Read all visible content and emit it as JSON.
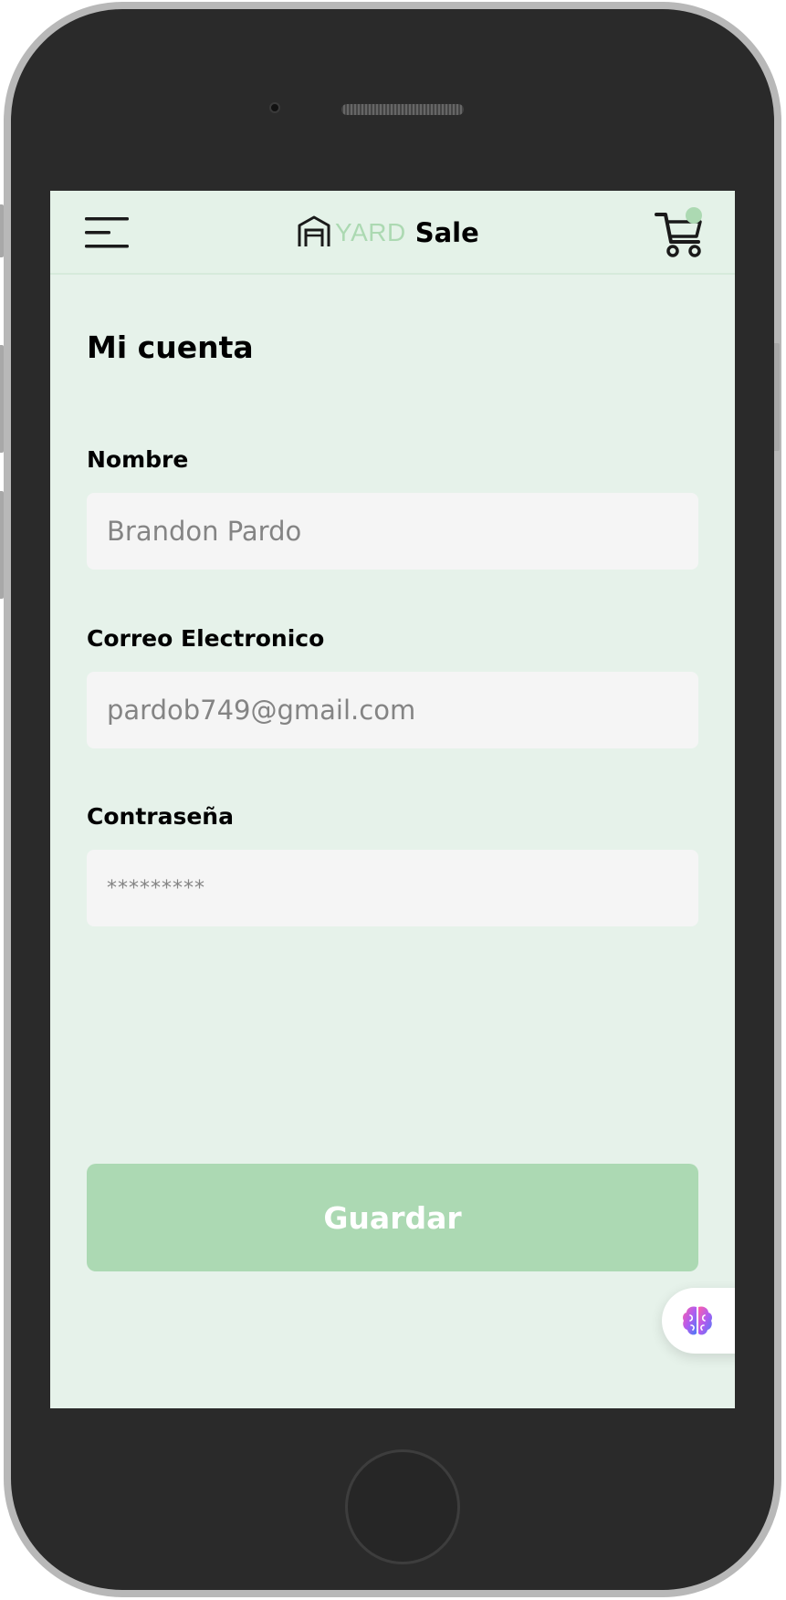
{
  "header": {
    "logo_yard": "YARD",
    "logo_sale": "Sale",
    "menu_icon": "hamburger-menu-icon",
    "cart_icon": "shopping-cart-icon"
  },
  "page": {
    "title": "Mi cuenta"
  },
  "form": {
    "name": {
      "label": "Nombre",
      "value": "Brandon Pardo"
    },
    "email": {
      "label": "Correo Electronico",
      "value": "pardob749@gmail.com"
    },
    "password": {
      "label": "Contraseña",
      "value": "*********"
    },
    "save_label": "Guardar"
  },
  "assistant": {
    "icon": "brain-icon"
  },
  "colors": {
    "accent": "#ACD9B2",
    "background": "#E6F2EA",
    "field_background": "#F5F5F5",
    "field_text": "#848484"
  }
}
